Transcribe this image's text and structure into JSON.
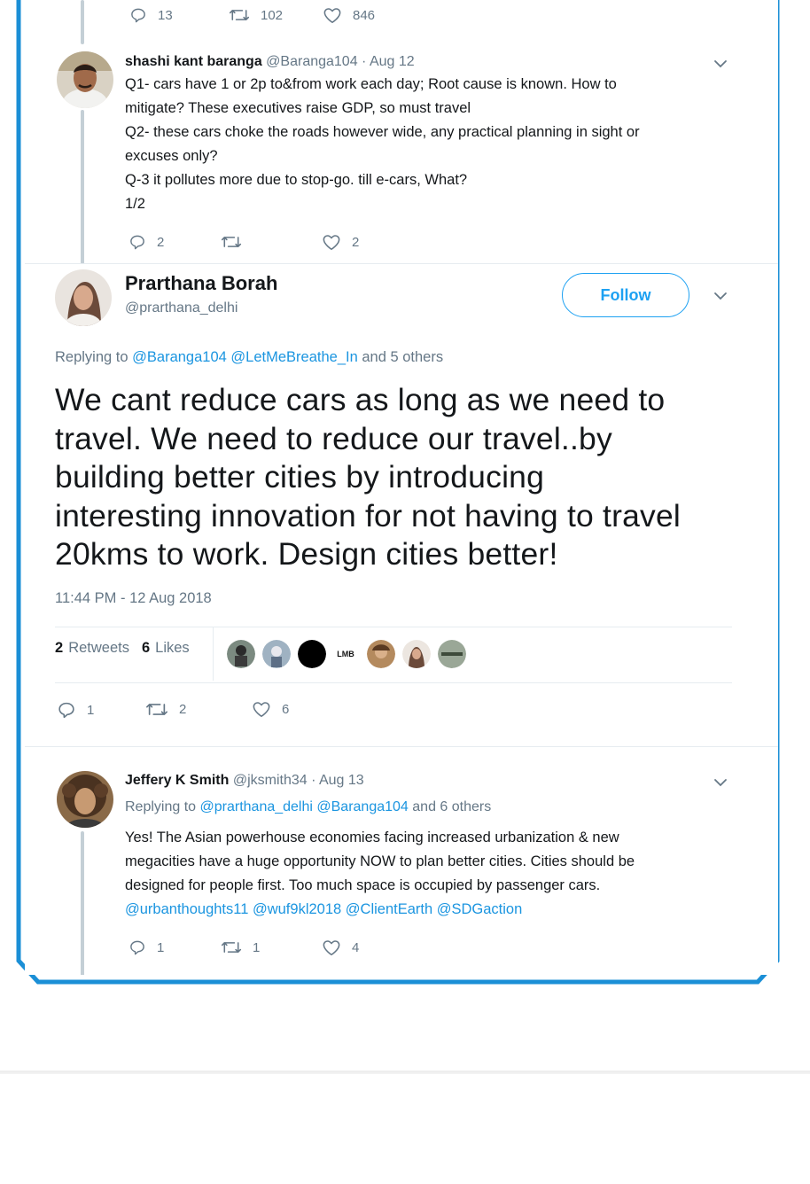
{
  "colors": {
    "frame_border": "#1b8fd6",
    "link": "#1b95e0",
    "text": "#14171a",
    "muted": "#657786",
    "follow": "#1da1f2"
  },
  "top_actions": {
    "replies": "13",
    "retweets": "102",
    "likes": "846"
  },
  "reply1": {
    "name": "shashi kant baranga",
    "handle_date": "@Baranga104 · Aug 12",
    "lines": [
      "Q1- cars have 1 or 2p to&from work each day; Root cause is known. How to",
      "mitigate? These executives raise GDP, so must travel",
      "Q2- these cars choke the roads however wide, any practical planning in sight or",
      "excuses only?",
      "Q-3 it pollutes more due to stop-go. till e-cars, What?",
      "1/2"
    ],
    "actions": {
      "replies": "2",
      "retweets": "",
      "likes": "2"
    }
  },
  "main_tweet": {
    "name": "Prarthana Borah",
    "handle": "@prarthana_delhi",
    "follow_label": "Follow",
    "replying_prefix": "Replying to",
    "replying_mentions": [
      "@Baranga104",
      "@LetMeBreathe_In"
    ],
    "replying_suffix": "and 5 others",
    "text_lines": [
      "We cant reduce cars as long as we need to",
      "travel. We need to reduce our travel..by",
      "building better cities by introducing",
      "interesting innovation for not having to travel",
      "20kms to work. Design cities better!"
    ],
    "timestamp": "11:44 PM - 12 Aug 2018",
    "retweet_count": "2",
    "retweet_label": "Retweets",
    "like_count": "6",
    "like_label": "Likes",
    "liker_badge_text": "LMB",
    "actions": {
      "replies": "1",
      "retweets": "2",
      "likes": "6"
    }
  },
  "reply2": {
    "name": "Jeffery K Smith",
    "handle_date": "@jksmith34 · Aug 13",
    "replying_prefix": "Replying to",
    "replying_mentions": [
      "@prarthana_delhi",
      "@Baranga104"
    ],
    "replying_suffix": "and 6 others",
    "lines": [
      "Yes! The Asian powerhouse economies facing increased urbanization & new",
      "megacities have a huge opportunity NOW to plan better cities. Cities should be",
      "designed for people first. Too much space is occupied by passenger cars."
    ],
    "mentions_line": "@urbanthoughts11 @wuf9kl2018 @ClientEarth @SDGaction",
    "actions": {
      "replies": "1",
      "retweets": "1",
      "likes": "4"
    }
  }
}
